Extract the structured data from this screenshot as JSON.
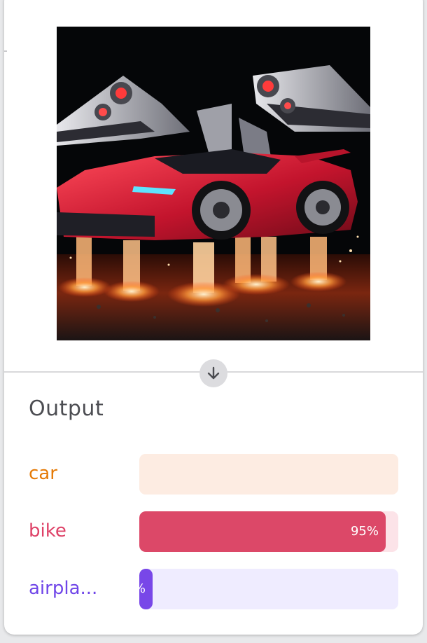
{
  "preview_image": {
    "description_icon": "red-flying-sports-car-image",
    "background_color": "#050608"
  },
  "action": {
    "icon": "arrow-down-icon"
  },
  "output": {
    "title": "Output",
    "results": [
      {
        "label": "car",
        "percent": 0,
        "percent_text": "",
        "label_color": "#e57a06",
        "bar_color": "#f2994a",
        "track_color": "#fdece2"
      },
      {
        "label": "bike",
        "percent": 95,
        "percent_text": "95%",
        "label_color": "#de4167",
        "bar_color": "#dc4868",
        "track_color": "#fce3e8"
      },
      {
        "label": "airpla...",
        "percent": 5,
        "percent_text": "%",
        "label_color": "#6f45e8",
        "bar_color": "#7847e8",
        "track_color": "#efecff"
      }
    ]
  }
}
